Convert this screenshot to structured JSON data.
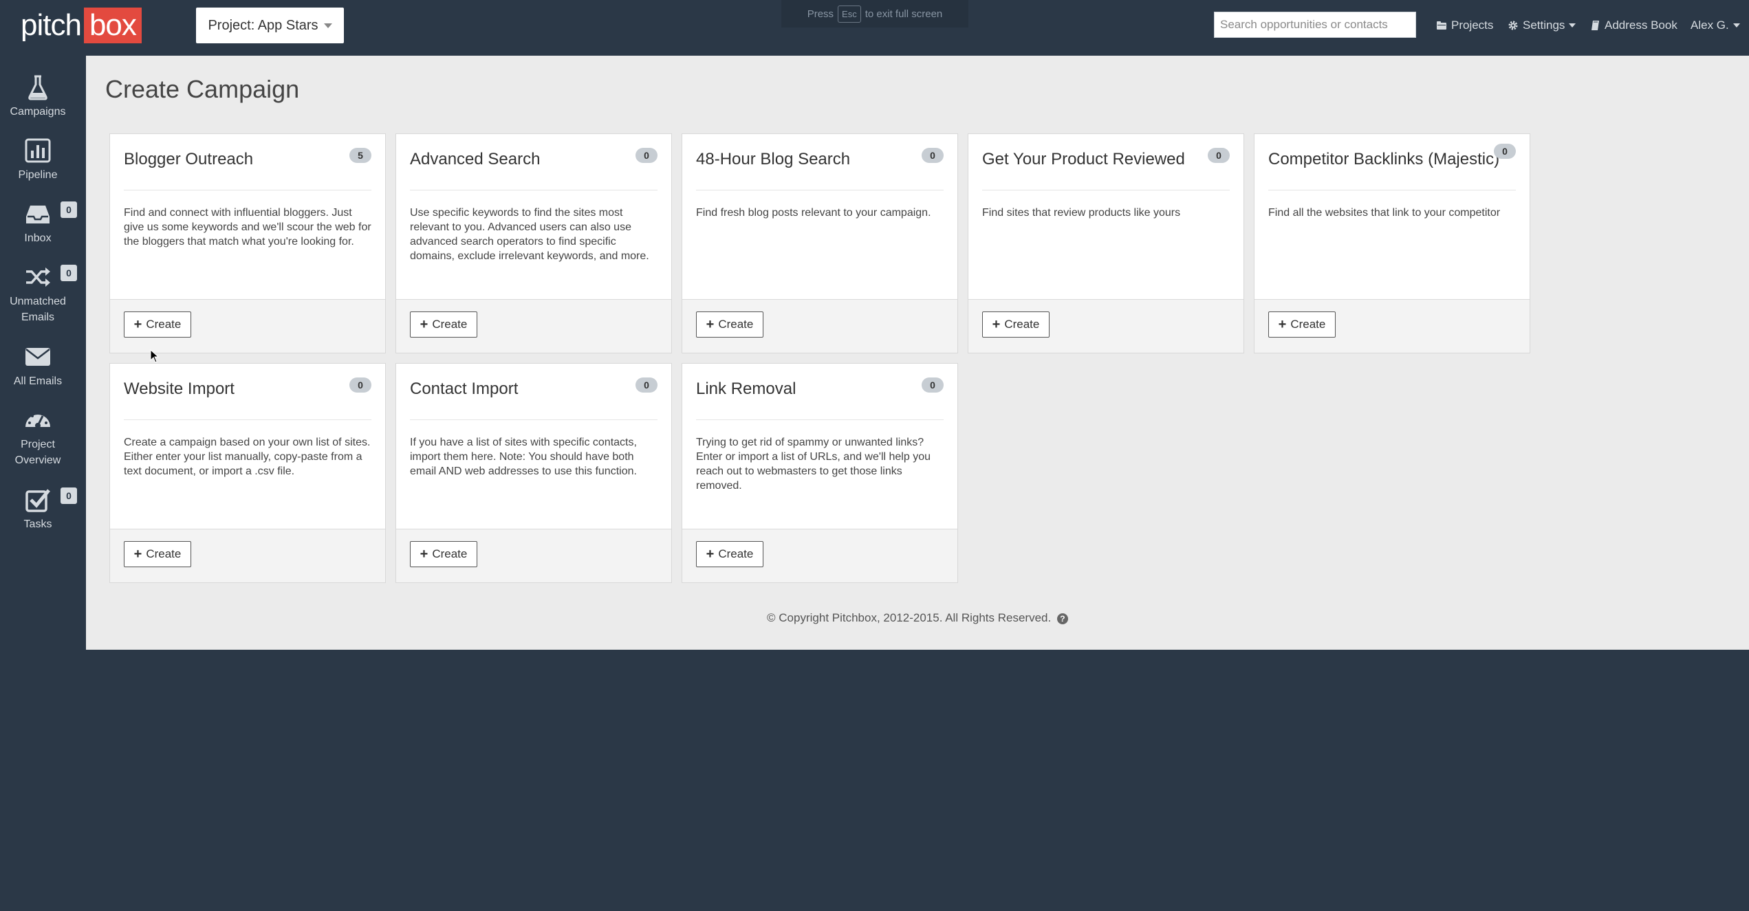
{
  "header": {
    "logo_part1": "pitch",
    "logo_part2": "box",
    "project_label": "Project: App Stars",
    "fullscreen_press": "Press",
    "fullscreen_key": "Esc",
    "fullscreen_suffix": "to exit full screen",
    "search_placeholder": "Search opportunities or contacts",
    "nav": {
      "projects": "Projects",
      "settings": "Settings",
      "address_book": "Address Book",
      "user": "Alex G."
    }
  },
  "sidebar": {
    "items": [
      {
        "label": "Campaigns",
        "icon": "flask-icon"
      },
      {
        "label": "Pipeline",
        "icon": "bar-chart-icon"
      },
      {
        "label": "Inbox",
        "icon": "inbox-icon",
        "badge": "0"
      },
      {
        "label": "Unmatched Emails",
        "icon": "shuffle-icon",
        "badge": "0"
      },
      {
        "label": "All Emails",
        "icon": "envelope-icon"
      },
      {
        "label": "Project Overview",
        "icon": "dashboard-icon"
      },
      {
        "label": "Tasks",
        "icon": "checkbox-icon",
        "badge": "0"
      }
    ]
  },
  "main": {
    "title": "Create Campaign",
    "create_label": "Create",
    "cards": [
      {
        "title": "Blogger Outreach",
        "badge": "5",
        "desc": "Find and connect with influential bloggers. Just give us some keywords and we'll scour the web for the bloggers that match what you're looking for."
      },
      {
        "title": "Advanced Search",
        "badge": "0",
        "desc": "Use specific keywords to find the sites most relevant to you. Advanced users can also use advanced search operators to find specific domains, exclude irrelevant keywords, and more."
      },
      {
        "title": "48-Hour Blog Search",
        "badge": "0",
        "desc": "Find fresh blog posts relevant to your campaign."
      },
      {
        "title": "Get Your Product Reviewed",
        "badge": "0",
        "desc": "Find sites that review products like yours"
      },
      {
        "title": "Competitor Backlinks (Majestic)",
        "badge": "0",
        "desc": "Find all the websites that link to your competitor"
      },
      {
        "title": "Website Import",
        "badge": "0",
        "desc": "Create a campaign based on your own list of sites. Either enter your list manually, copy-paste from a text document, or import a .csv file."
      },
      {
        "title": "Contact Import",
        "badge": "0",
        "desc": "If you have a list of sites with specific contacts, import them here. Note: You should have both email AND web addresses to use this function."
      },
      {
        "title": "Link Removal",
        "badge": "0",
        "desc": "Trying to get rid of spammy or unwanted links? Enter or import a list of URLs, and we'll help you reach out to webmasters to get those links removed."
      }
    ],
    "copyright": "© Copyright Pitchbox, 2012-2015. All Rights Reserved."
  },
  "colors": {
    "chrome": "#2b3847",
    "brand_red": "#e34a3f",
    "content_bg": "#ebebeb"
  }
}
